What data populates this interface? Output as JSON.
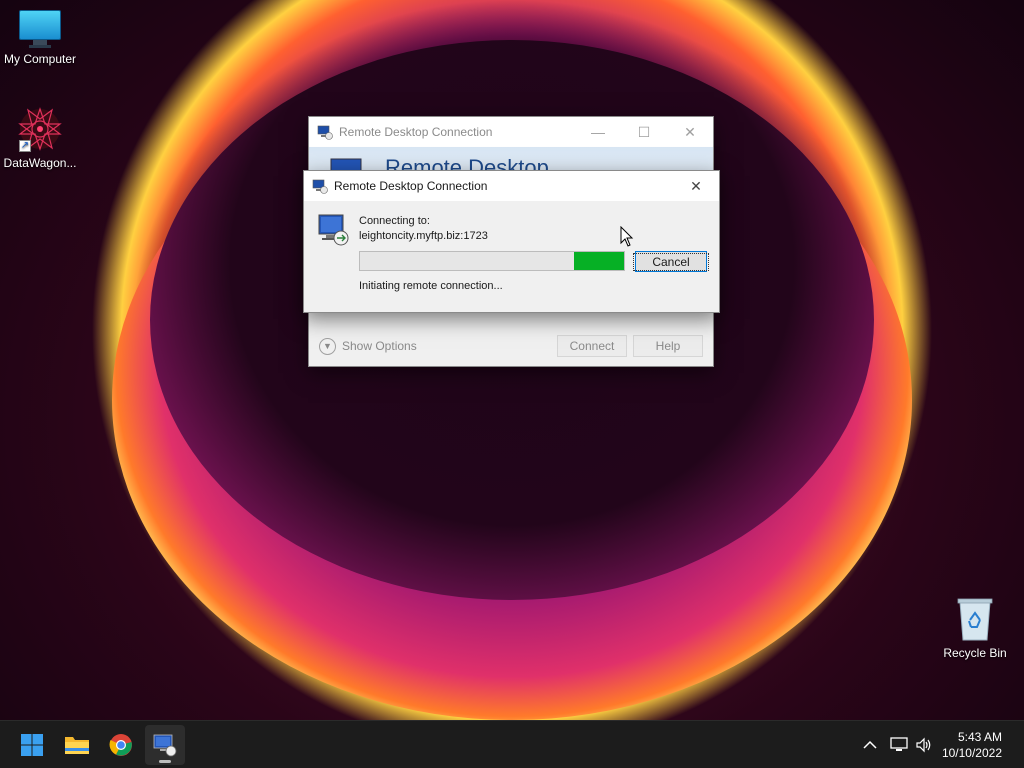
{
  "desktop": {
    "icons": [
      {
        "label": "My Computer",
        "icon": "monitor-icon"
      },
      {
        "label": "DataWagon...",
        "icon": "datawagon-app-icon"
      },
      {
        "label": "Recycle Bin",
        "icon": "recycle-bin-icon"
      }
    ]
  },
  "background_window": {
    "title": "Remote Desktop Connection",
    "banner_text": "Remote Desktop",
    "show_options_label": "Show Options",
    "connect_label": "Connect",
    "help_label": "Help",
    "minimize_glyph": "—",
    "maximize_glyph": "☐",
    "close_glyph": "✕"
  },
  "dialog": {
    "title": "Remote Desktop Connection",
    "close_glyph": "✕",
    "connecting_label": "Connecting to:",
    "host": "leightoncity.myftp.biz:1723",
    "progress_fill_start": 0.81,
    "progress_fill_end": 1.0,
    "progress_color": "#06b025",
    "cancel_label": "Cancel",
    "status_text": "Initiating remote connection..."
  },
  "taskbar": {
    "items": [
      {
        "name": "start-button",
        "icon": "windows-logo-icon"
      },
      {
        "name": "file-explorer",
        "icon": "folder-icon"
      },
      {
        "name": "chrome",
        "icon": "chrome-icon"
      },
      {
        "name": "remote-desktop",
        "icon": "remote-desktop-icon",
        "active": true
      }
    ],
    "tray": {
      "chevron": "^",
      "network_icon": "network-icon",
      "volume_icon": "volume-icon"
    },
    "clock": {
      "time": "5:43 AM",
      "date": "10/10/2022"
    }
  }
}
